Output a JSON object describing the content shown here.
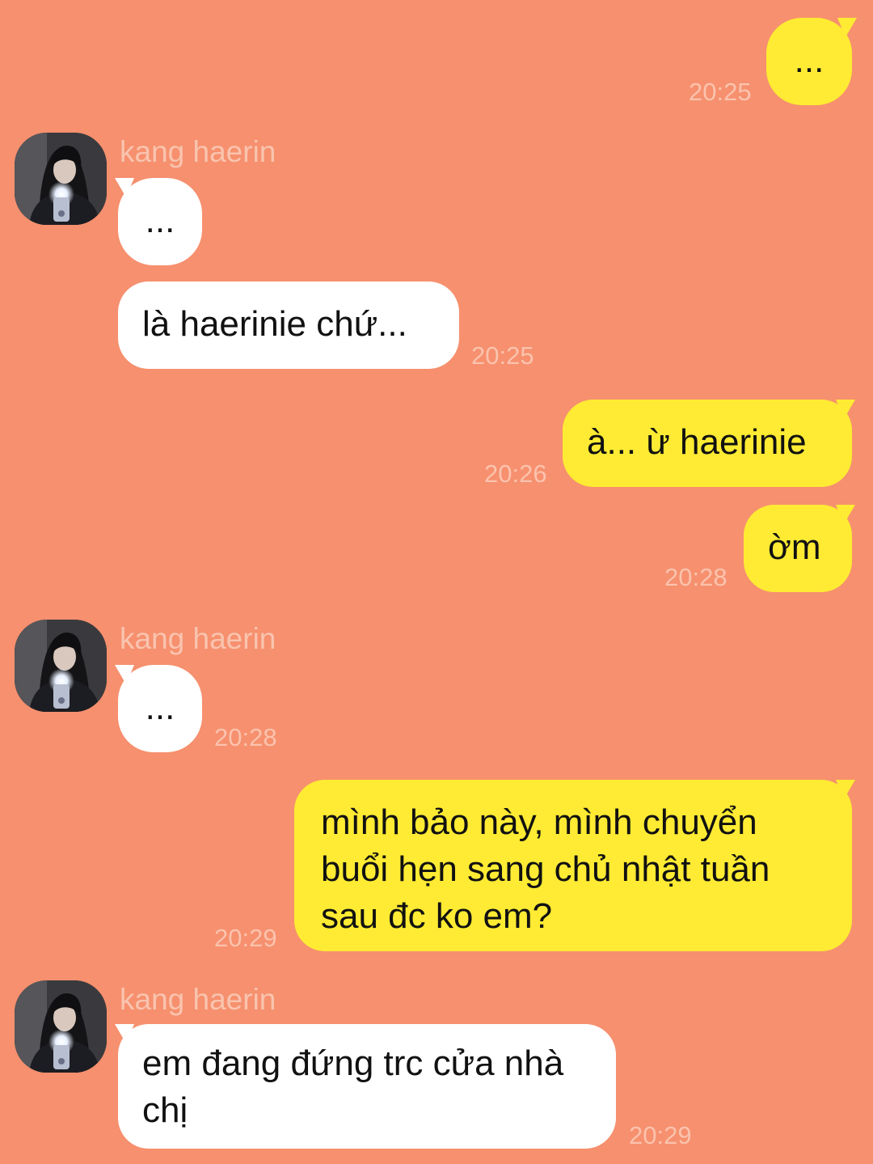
{
  "contact": {
    "name": "kang haerin"
  },
  "messages": [
    {
      "id": "m1",
      "side": "out",
      "text": "...",
      "time": "20:25"
    },
    {
      "id": "m2",
      "side": "in",
      "text": "...",
      "time": ""
    },
    {
      "id": "m3",
      "side": "in",
      "text": "là haerinie chứ...",
      "time": "20:25"
    },
    {
      "id": "m4",
      "side": "out",
      "text": "à... ừ haerinie",
      "time": "20:26"
    },
    {
      "id": "m5",
      "side": "out",
      "text": "ờm",
      "time": "20:28"
    },
    {
      "id": "m6",
      "side": "in",
      "text": "...",
      "time": "20:28"
    },
    {
      "id": "m7",
      "side": "out",
      "text": "mình bảo này, mình chuyển buổi hẹn sang chủ nhật tuần sau đc ko em?",
      "time": "20:29"
    },
    {
      "id": "m8",
      "side": "in",
      "text": "em đang đứng trc cửa nhà chị",
      "time": "20:29"
    }
  ],
  "colors": {
    "background": "#F6906E",
    "incoming_bubble": "#FFFFFF",
    "outgoing_bubble": "#FFEB33",
    "meta_text": "#FBC3AE"
  },
  "icons": {
    "avatar": "profile-photo"
  }
}
